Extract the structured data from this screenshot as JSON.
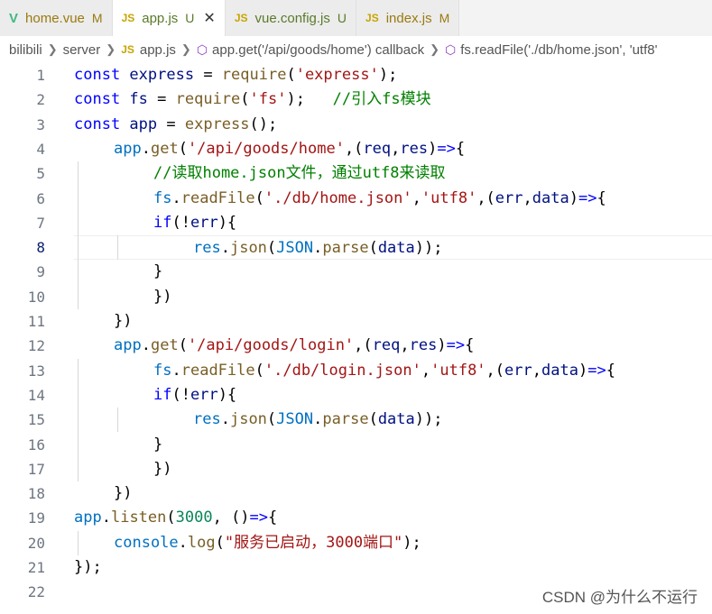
{
  "tabs": [
    {
      "icon": "V",
      "icon_kind": "vue",
      "name": "home.vue",
      "status": "M",
      "state": "mod",
      "active": false
    },
    {
      "icon": "JS",
      "icon_kind": "js",
      "name": "app.js",
      "status": "U",
      "state": "untr",
      "active": true,
      "close": "✕"
    },
    {
      "icon": "JS",
      "icon_kind": "js",
      "name": "vue.config.js",
      "status": "U",
      "state": "untr",
      "active": false
    },
    {
      "icon": "JS",
      "icon_kind": "js",
      "name": "index.js",
      "status": "M",
      "state": "mod",
      "active": false
    }
  ],
  "breadcrumb": {
    "root": "bilibili",
    "folder": "server",
    "file_icon": "JS",
    "file": "app.js",
    "symbol1": "app.get('/api/goods/home') callback",
    "symbol2": "fs.readFile('./db/home.json', 'utf8'"
  },
  "lines": [
    {
      "n": "1",
      "indent": 0,
      "tokens": [
        [
          "kw",
          "const "
        ],
        [
          "var",
          "express"
        ],
        [
          "pun",
          " = "
        ],
        [
          "fn",
          "require"
        ],
        [
          "pun",
          "("
        ],
        [
          "str",
          "'express'"
        ],
        [
          "pun",
          ");"
        ]
      ]
    },
    {
      "n": "2",
      "indent": 0,
      "tokens": [
        [
          "kw",
          "const "
        ],
        [
          "var",
          "fs"
        ],
        [
          "pun",
          " = "
        ],
        [
          "fn",
          "require"
        ],
        [
          "pun",
          "("
        ],
        [
          "str",
          "'fs'"
        ],
        [
          "pun",
          ");   "
        ],
        [
          "cm",
          "//引入fs模块"
        ]
      ]
    },
    {
      "n": "3",
      "indent": 0,
      "tokens": [
        [
          "kw",
          "const "
        ],
        [
          "var",
          "app"
        ],
        [
          "pun",
          " = "
        ],
        [
          "fn",
          "express"
        ],
        [
          "pun",
          "();"
        ]
      ]
    },
    {
      "n": "4",
      "indent": 1,
      "tokens": [
        [
          "blue",
          "app"
        ],
        [
          "pun",
          "."
        ],
        [
          "fn",
          "get"
        ],
        [
          "pun",
          "("
        ],
        [
          "str",
          "'/api/goods/home'"
        ],
        [
          "pun",
          ",("
        ],
        [
          "var",
          "req"
        ],
        [
          "pun",
          ","
        ],
        [
          "var",
          "res"
        ],
        [
          "pun",
          ")"
        ],
        [
          "arrow",
          "=>"
        ],
        [
          "pun",
          "{"
        ]
      ]
    },
    {
      "n": "5",
      "indent": 2,
      "tokens": [
        [
          "cm",
          "//读取home.json文件，通过utf8来读取"
        ]
      ]
    },
    {
      "n": "6",
      "indent": 2,
      "tokens": [
        [
          "blue",
          "fs"
        ],
        [
          "pun",
          "."
        ],
        [
          "fn",
          "readFile"
        ],
        [
          "pun",
          "("
        ],
        [
          "str",
          "'./db/home.json'"
        ],
        [
          "pun",
          ","
        ],
        [
          "str",
          "'utf8'"
        ],
        [
          "pun",
          ",("
        ],
        [
          "var",
          "err"
        ],
        [
          "pun",
          ","
        ],
        [
          "var",
          "data"
        ],
        [
          "pun",
          ")"
        ],
        [
          "arrow",
          "=>"
        ],
        [
          "pun",
          "{"
        ]
      ]
    },
    {
      "n": "7",
      "indent": 2,
      "tokens": [
        [
          "kw",
          "if"
        ],
        [
          "pun",
          "(!"
        ],
        [
          "var",
          "err"
        ],
        [
          "pun",
          "){"
        ]
      ]
    },
    {
      "n": "8",
      "indent": 3,
      "current": true,
      "tokens": [
        [
          "blue",
          "res"
        ],
        [
          "pun",
          "."
        ],
        [
          "fn",
          "json"
        ],
        [
          "pun",
          "("
        ],
        [
          "blue",
          "JSON"
        ],
        [
          "pun",
          "."
        ],
        [
          "fn",
          "parse"
        ],
        [
          "pun",
          "("
        ],
        [
          "var",
          "data"
        ],
        [
          "pun",
          "));"
        ]
      ]
    },
    {
      "n": "9",
      "indent": 2,
      "tokens": [
        [
          "pun",
          "}"
        ]
      ]
    },
    {
      "n": "10",
      "indent": 2,
      "tokens": [
        [
          "pun",
          "})"
        ]
      ]
    },
    {
      "n": "11",
      "indent": 1,
      "tokens": [
        [
          "pun",
          "})"
        ]
      ]
    },
    {
      "n": "12",
      "indent": 1,
      "tokens": [
        [
          "blue",
          "app"
        ],
        [
          "pun",
          "."
        ],
        [
          "fn",
          "get"
        ],
        [
          "pun",
          "("
        ],
        [
          "str",
          "'/api/goods/login'"
        ],
        [
          "pun",
          ",("
        ],
        [
          "var",
          "req"
        ],
        [
          "pun",
          ","
        ],
        [
          "var",
          "res"
        ],
        [
          "pun",
          ")"
        ],
        [
          "arrow",
          "=>"
        ],
        [
          "pun",
          "{"
        ]
      ]
    },
    {
      "n": "13",
      "indent": 2,
      "tokens": [
        [
          "blue",
          "fs"
        ],
        [
          "pun",
          "."
        ],
        [
          "fn",
          "readFile"
        ],
        [
          "pun",
          "("
        ],
        [
          "str",
          "'./db/login.json'"
        ],
        [
          "pun",
          ","
        ],
        [
          "str",
          "'utf8'"
        ],
        [
          "pun",
          ",("
        ],
        [
          "var",
          "err"
        ],
        [
          "pun",
          ","
        ],
        [
          "var",
          "data"
        ],
        [
          "pun",
          ")"
        ],
        [
          "arrow",
          "=>"
        ],
        [
          "pun",
          "{"
        ]
      ]
    },
    {
      "n": "14",
      "indent": 2,
      "tokens": [
        [
          "kw",
          "if"
        ],
        [
          "pun",
          "(!"
        ],
        [
          "var",
          "err"
        ],
        [
          "pun",
          "){"
        ]
      ]
    },
    {
      "n": "15",
      "indent": 3,
      "tokens": [
        [
          "blue",
          "res"
        ],
        [
          "pun",
          "."
        ],
        [
          "fn",
          "json"
        ],
        [
          "pun",
          "("
        ],
        [
          "blue",
          "JSON"
        ],
        [
          "pun",
          "."
        ],
        [
          "fn",
          "parse"
        ],
        [
          "pun",
          "("
        ],
        [
          "var",
          "data"
        ],
        [
          "pun",
          "));"
        ]
      ]
    },
    {
      "n": "16",
      "indent": 2,
      "tokens": [
        [
          "pun",
          "}"
        ]
      ]
    },
    {
      "n": "17",
      "indent": 2,
      "tokens": [
        [
          "pun",
          "})"
        ]
      ]
    },
    {
      "n": "18",
      "indent": 1,
      "tokens": [
        [
          "pun",
          "})"
        ]
      ]
    },
    {
      "n": "19",
      "indent": 0,
      "tokens": [
        [
          "blue",
          "app"
        ],
        [
          "pun",
          "."
        ],
        [
          "fn",
          "listen"
        ],
        [
          "pun",
          "("
        ],
        [
          "num",
          "3000"
        ],
        [
          "pun",
          ", ()"
        ],
        [
          "arrow",
          "=>"
        ],
        [
          "pun",
          "{"
        ]
      ]
    },
    {
      "n": "20",
      "indent": 1,
      "tokens": [
        [
          "blue",
          "console"
        ],
        [
          "pun",
          "."
        ],
        [
          "fn",
          "log"
        ],
        [
          "pun",
          "("
        ],
        [
          "str",
          "\"服务已启动，3000端口\""
        ],
        [
          "pun",
          ");"
        ]
      ]
    },
    {
      "n": "21",
      "indent": 0,
      "tokens": [
        [
          "pun",
          "});"
        ]
      ]
    },
    {
      "n": "22",
      "indent": 0,
      "tokens": []
    }
  ],
  "watermark": "CSDN @为什么不运行"
}
